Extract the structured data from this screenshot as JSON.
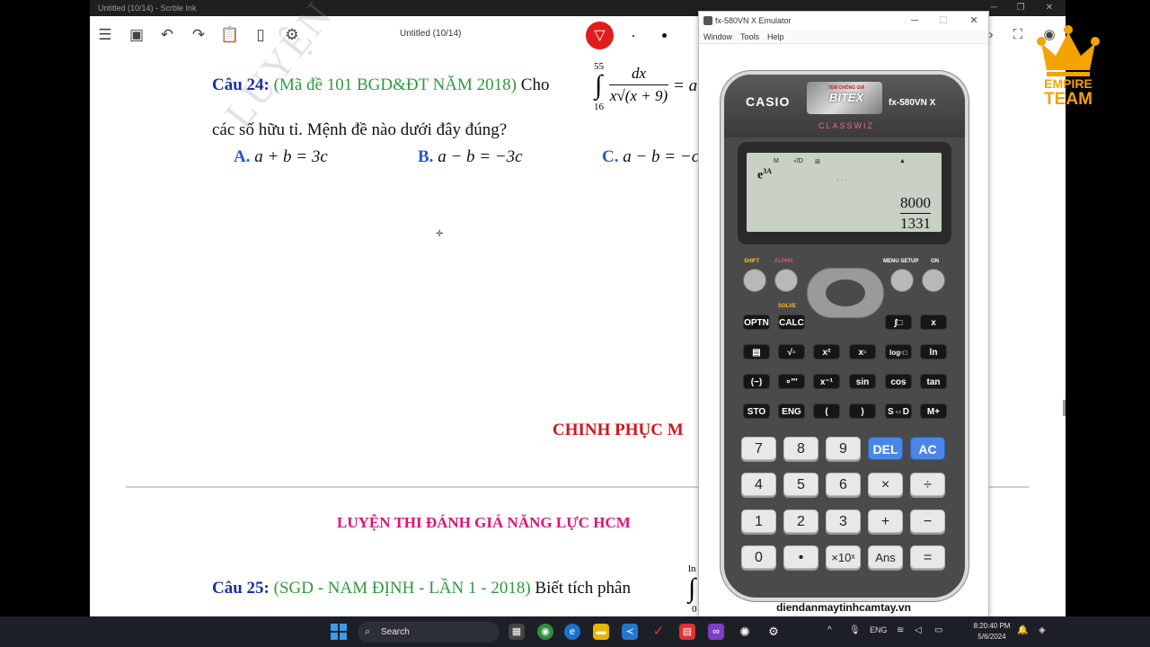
{
  "ink_window": {
    "title": "Untitled (10/14) - Scrble Ink",
    "doc_title": "Untitled (10/14)"
  },
  "question24": {
    "number": "Câu 24:",
    "source": "(Mã đề 101 BGD&ĐT NĂM 2018)",
    "lead": "Cho",
    "int_upper": "55",
    "int_lower": "16",
    "frac_num": "dx",
    "frac_den": "x√(x + 9)",
    "eq_tail": "= a",
    "line2": "các số hữu tỉ. Mệnh đề nào dưới đây đúng?",
    "options": [
      {
        "label": "A.",
        "expr": "a + b = 3c"
      },
      {
        "label": "B.",
        "expr": "a − b = −3c"
      },
      {
        "label": "C.",
        "expr": "a − b = −c"
      }
    ]
  },
  "watermark": "LUYỆN THI",
  "footer_heading": "CHINH PHỤC M",
  "header_heading": "LUYỆN THI ĐÁNH GIÁ NĂNG LỰC HCM",
  "question25": {
    "number": "Câu 25:",
    "source": "(SGD - NAM ĐỊNH - LẦN 1 - 2018)",
    "text": "Biết tích phân",
    "int_upper": "ln",
    "int_lower": "0"
  },
  "empire": {
    "line1": "EMPIRE",
    "line2": "TEAM",
    "color": "#f5a300"
  },
  "emulator": {
    "title": "fx-580VN X Emulator",
    "menu": [
      "Window",
      "Tools",
      "Help"
    ],
    "brand": "CASIO",
    "model": "fx-580VN X",
    "sticker_top": "TEM CHỐNG GIẢ",
    "sticker_main": "BITEX",
    "series": "CLASSWIZ",
    "lcd": {
      "indicators": [
        "M",
        "√/D",
        "⊞",
        "▲"
      ],
      "input_base": "e",
      "input_exp": "3A",
      "result_num": "8000",
      "result_den": "1331"
    },
    "top_labels": {
      "shift": "SHIFT",
      "alpha": "ALPHA",
      "menu": "MENU SETUP",
      "on": "ON"
    },
    "fn_row1": [
      "OPTN",
      "CALC",
      "∫□",
      "x"
    ],
    "fn_row2": [
      "▤",
      "√▫",
      "x²",
      "x▫",
      "log▫□",
      "ln"
    ],
    "fn_row3": [
      "(−)",
      "∘′″",
      "x⁻¹",
      "sin",
      "cos",
      "tan"
    ],
    "fn_row4": [
      "STO",
      "ENG",
      "(",
      ")",
      "S⇔D",
      "M+"
    ],
    "num_rows": [
      [
        "7",
        "8",
        "9",
        "DEL",
        "AC"
      ],
      [
        "4",
        "5",
        "6",
        "×",
        "÷"
      ],
      [
        "1",
        "2",
        "3",
        "+",
        "−"
      ],
      [
        "0",
        "•",
        "×10ˣ",
        "Ans",
        "="
      ]
    ],
    "site": "diendanmaytinhcamtay.vn"
  },
  "taskbar": {
    "search": "Search",
    "lang": "ENG",
    "time": "8:20:40 PM",
    "date": "5/6/2024"
  }
}
